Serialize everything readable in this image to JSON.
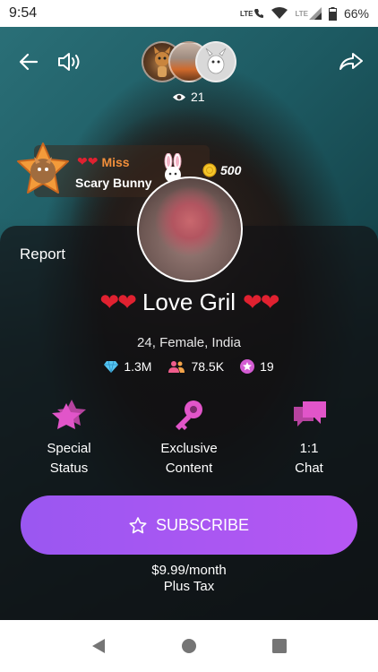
{
  "status_bar": {
    "time": "9:54",
    "network_label_1": "LTE",
    "network_label_2": "LTE",
    "battery_percent": "66%"
  },
  "stream": {
    "viewer_count": "21",
    "host": {
      "name_line_1": "Miss",
      "name_line_2": "Scary Bunny",
      "coins": "500"
    }
  },
  "card": {
    "report_label": "Report",
    "title": "Love Gril",
    "title_hearts": "❤❤",
    "profile_info": "24, Female, India",
    "stats": {
      "diamonds": "1.3M",
      "followers": "78.5K",
      "stars": "19"
    },
    "features": [
      {
        "label": "Special\nStatus",
        "icon": "star-icon"
      },
      {
        "label": "Exclusive\nContent",
        "icon": "key-icon"
      },
      {
        "label": "1:1\nChat",
        "icon": "chat-icon"
      }
    ],
    "subscribe_label": "SUBSCRIBE",
    "price_line_1": "$9.99/month",
    "price_line_2": "Plus Tax"
  },
  "colors": {
    "accent_purple": "#a657f2",
    "heart_red": "#e02130",
    "host_name_orange": "#f28f3b",
    "feature_icon_pink": "#e155c9"
  }
}
